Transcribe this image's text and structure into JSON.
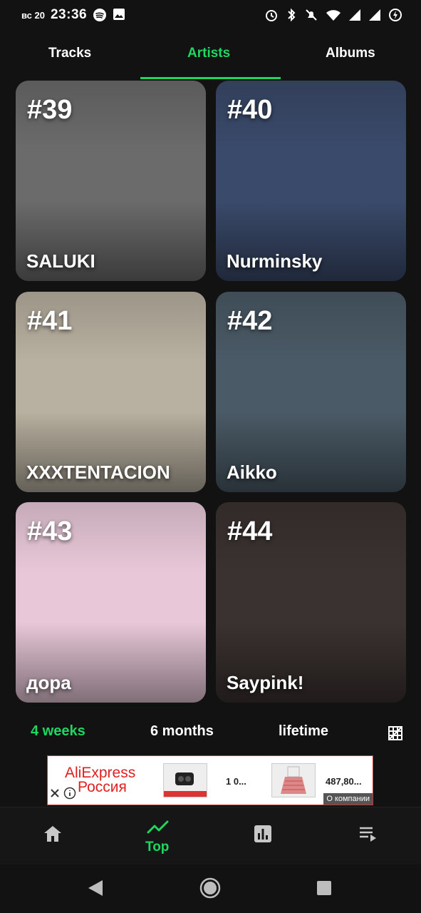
{
  "status_bar": {
    "day": "вс 20",
    "time": "23:36"
  },
  "tabs": [
    {
      "label": "Tracks",
      "active": false
    },
    {
      "label": "Artists",
      "active": true
    },
    {
      "label": "Albums",
      "active": false
    }
  ],
  "artists": [
    {
      "rank": "#39",
      "name": "SALUKI",
      "color": "#6b6b6b"
    },
    {
      "rank": "#40",
      "name": "Nurminsky",
      "color": "#3a4a6a"
    },
    {
      "rank": "#41",
      "name": "XXXTENTACION",
      "color": "#b8b0a0"
    },
    {
      "rank": "#42",
      "name": "Aikko",
      "color": "#4a5a66"
    },
    {
      "rank": "#43",
      "name": "дора",
      "color": "#e8c8d8"
    },
    {
      "rank": "#44",
      "name": "Saypink!",
      "color": "#3a3230"
    }
  ],
  "period_selector": {
    "options": [
      "4 weeks",
      "6 months",
      "lifetime"
    ],
    "active": "4 weeks"
  },
  "ad": {
    "brand_line1": "AliExpress",
    "brand_line2": "Россия",
    "price1": "1 0...",
    "price2": "487,80...",
    "company_label": "О компании"
  },
  "bottom_nav": {
    "active_label": "Top",
    "items": [
      "home-icon",
      "trending-icon",
      "chart-icon",
      "queue-icon"
    ]
  },
  "colors": {
    "accent": "#1ed760",
    "background": "#121212"
  }
}
